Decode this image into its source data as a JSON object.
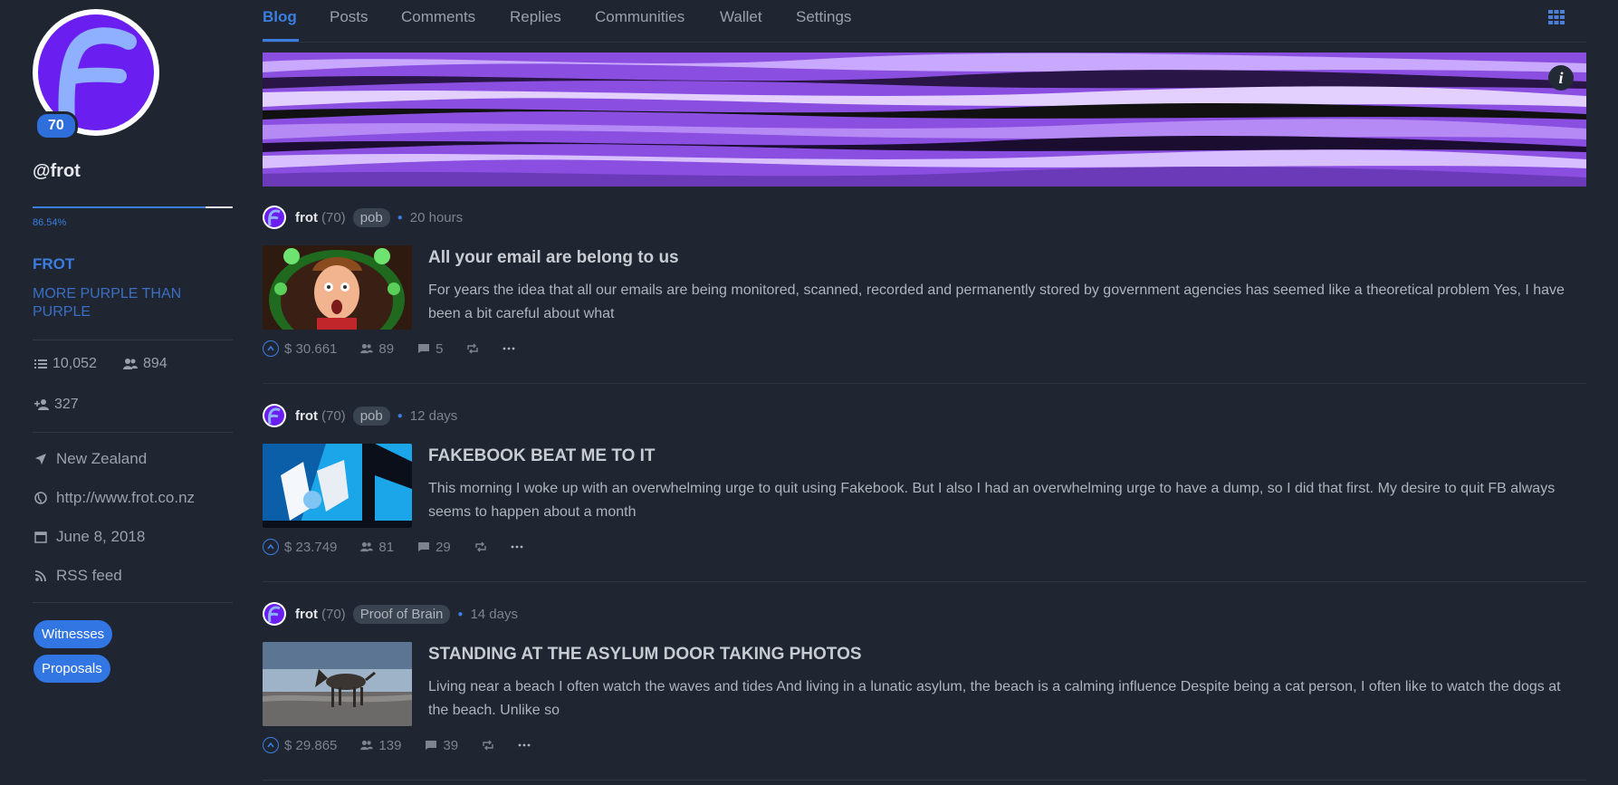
{
  "profile": {
    "reputation": "70",
    "username": "@frot",
    "power_pct": "86.54%",
    "power_fraction": 0.8654,
    "name": "FROT",
    "about": "MORE PURPLE THAN PURPLE",
    "posts_count": "10,052",
    "followers": "894",
    "following": "327",
    "location": "New Zealand",
    "website": "http://www.frot.co.nz",
    "joined": "June 8, 2018",
    "rss": "RSS feed",
    "witnesses_label": "Witnesses",
    "proposals_label": "Proposals"
  },
  "nav": {
    "tabs": [
      "Blog",
      "Posts",
      "Comments",
      "Replies",
      "Communities",
      "Wallet",
      "Settings"
    ],
    "active": "Blog"
  },
  "cover": {
    "info_label": "i"
  },
  "posts": [
    {
      "author": "frot",
      "rep": "(70)",
      "community": "pob",
      "time": "20 hours",
      "title": "All your email are belong to us",
      "body": "For years the idea that all our emails are being monitored, scanned, recorded and permanently stored by government agencies has seemed like a theoretical problem Yes, I have been a bit careful about what",
      "payout": "$ 30.661",
      "votes": "89",
      "comments": "5"
    },
    {
      "author": "frot",
      "rep": "(70)",
      "community": "pob",
      "time": "12 days",
      "title": "FAKEBOOK BEAT ME TO IT",
      "body": "This morning I woke up with an overwhelming urge to quit using Fakebook. But I also I had an overwhelming urge to have a dump, so I did that first. My desire to quit FB always seems to happen about a month",
      "payout": "$ 23.749",
      "votes": "81",
      "comments": "29"
    },
    {
      "author": "frot",
      "rep": "(70)",
      "community": "Proof of Brain",
      "time": "14 days",
      "title": "STANDING AT THE ASYLUM DOOR TAKING PHOTOS",
      "body": "Living near a beach I often watch the waves and tides And living in a lunatic asylum, the beach is a calming influence Despite being a cat person, I often like to watch the dogs at the beach. Unlike so",
      "payout": "$ 29.865",
      "votes": "139",
      "comments": "39"
    }
  ],
  "colors": {
    "accent": "#3b7de0",
    "background": "#1f2631",
    "avatar_purple": "#6a1ef0"
  }
}
